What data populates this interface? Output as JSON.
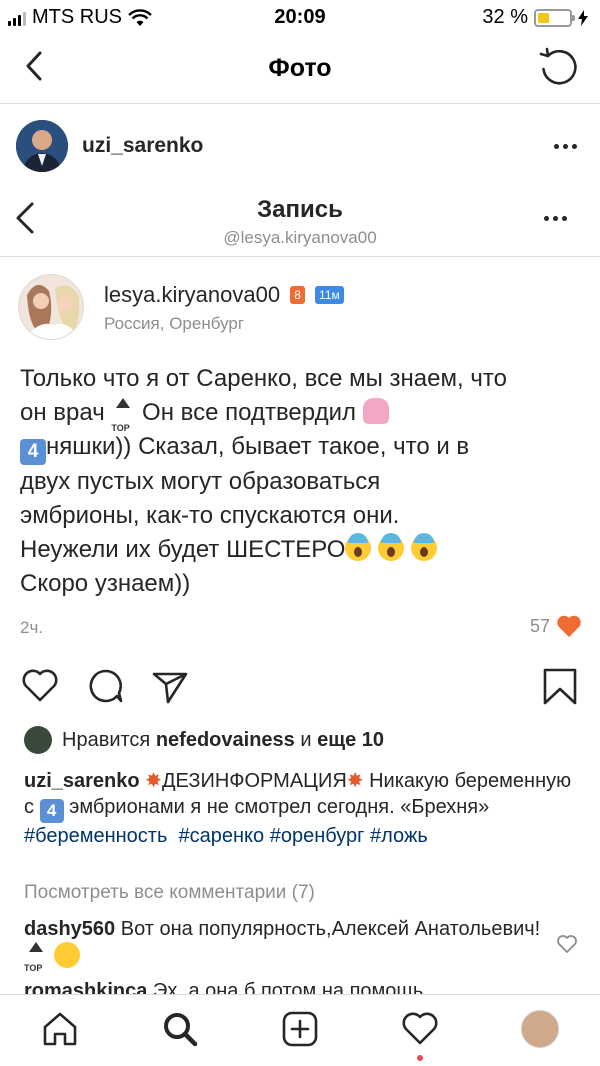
{
  "status_bar": {
    "carrier": "MTS RUS",
    "time": "20:09",
    "battery": "32 %",
    "battery_level": 0.32
  },
  "header": {
    "title": "Фото"
  },
  "post": {
    "owner_username": "uzi_sarenko"
  },
  "embedded": {
    "title": "Запись",
    "subtitle": "@lesya.kiryanova00",
    "author": {
      "name": "lesya.kiryanova00",
      "badge_1": "8",
      "badge_2": "11м",
      "location": "Россия, Оренбург"
    },
    "story": {
      "line1": "Только что я от Саренко, все мы знаем, что",
      "line2_a": "он врач",
      "line2_b": " Он все подтвердил",
      "line3_box": "4",
      "line3": "няшки)) Сказал, бывает такое, что и в",
      "line4": "двух пустых могут образоваться",
      "line5": "эмбрионы, как-то спускаются они.",
      "line6": "Неужели их будет ШЕСТЕРО",
      "line7": "Скоро узнаем))"
    },
    "time": "2ч.",
    "likes": "57"
  },
  "liked_by": {
    "prefix": "Нравится",
    "user": "nefedovainess",
    "middle": "и",
    "rest": "еще 10"
  },
  "caption": {
    "username": "uzi_sarenko",
    "headline": "ДЕЗИНФОРМАЦИЯ",
    "text_1": " Никакую беременную с ",
    "box": "4",
    "text_2": " эмбрионами я не смотрел сегодня. «Брехня» ",
    "tags": [
      "#беременность",
      "#саренко",
      "#оренбург",
      "#ложь"
    ]
  },
  "comments": {
    "view_all": "Посмотреть все комментарии (7)",
    "items": [
      {
        "user": "dashy560",
        "text": "Вот она популярность,Алексей Анатольевич!"
      },
      {
        "user": "romashkinca",
        "text": "Эх, а она б потом на помощь"
      }
    ]
  },
  "icons": {
    "back": "chevron-left-icon",
    "refresh": "refresh-icon",
    "more": "more-icon",
    "like": "heart-icon",
    "comment": "comment-icon",
    "share": "send-icon",
    "save": "bookmark-icon",
    "home": "home-icon",
    "search": "search-icon",
    "new_post": "add-icon",
    "activity": "heart-icon",
    "profile": "avatar"
  },
  "colors": {
    "heart_red": "#ed4956",
    "badge_orange": "#f06b32",
    "badge_blue": "#3d8ae5",
    "hashtag": "#003569"
  }
}
